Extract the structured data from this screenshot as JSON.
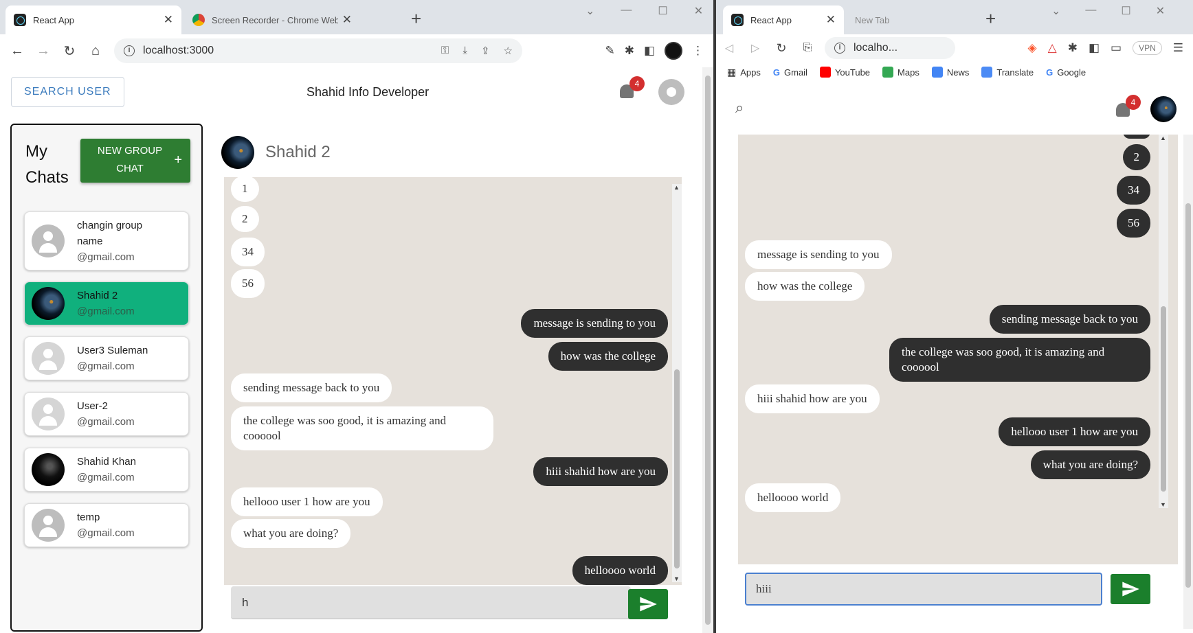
{
  "left_window": {
    "tabs": [
      {
        "title": "React App",
        "active": true
      },
      {
        "title": "Screen Recorder - Chrome Web Sto",
        "active": false
      }
    ],
    "url": "localhost:3000",
    "header": {
      "search_button": "SEARCH USER",
      "brand": "Shahid Info Developer",
      "notification_count": "4"
    },
    "sidebar": {
      "title_line1": "My",
      "title_line2": "Chats",
      "new_group_line1": "NEW GROUP",
      "new_group_line2": "CHAT",
      "new_group_icon": "+",
      "chats": [
        {
          "name": "changin group",
          "name2": "name",
          "email": "@gmail.com",
          "selected": false
        },
        {
          "name": "Shahid 2",
          "email": "@gmail.com",
          "selected": true
        },
        {
          "name": "User3 Suleman",
          "email": "@gmail.com",
          "selected": false
        },
        {
          "name": "User-2",
          "email": "@gmail.com",
          "selected": false
        },
        {
          "name": "Shahid Khan",
          "email": "@gmail.com",
          "selected": false
        },
        {
          "name": "temp",
          "email": "@gmail.com",
          "selected": false
        }
      ]
    },
    "chat": {
      "recipient": "Shahid 2",
      "messages": [
        {
          "text": "1",
          "dir": "in"
        },
        {
          "text": "2",
          "dir": "in"
        },
        {
          "text": "34",
          "dir": "in"
        },
        {
          "text": "56",
          "dir": "in"
        },
        {
          "text": "message is sending to you",
          "dir": "out"
        },
        {
          "text": "how was the college",
          "dir": "out"
        },
        {
          "text": "sending message back to you",
          "dir": "in"
        },
        {
          "text": "the college was soo good, it is amazing and coooool",
          "dir": "in"
        },
        {
          "text": "hiii shahid how are you",
          "dir": "out"
        },
        {
          "text": "hellooo user 1 how are you",
          "dir": "in"
        },
        {
          "text": "what you are doing?",
          "dir": "in"
        },
        {
          "text": "helloooo world",
          "dir": "out"
        }
      ],
      "input_value": "h"
    }
  },
  "right_window": {
    "tabs": [
      {
        "title": "React App",
        "active": true
      },
      {
        "title": "New Tab",
        "active": false
      }
    ],
    "url": "localho...",
    "bookmarks": [
      "Apps",
      "Gmail",
      "YouTube",
      "Maps",
      "News",
      "Translate",
      "Google"
    ],
    "vpn_label": "VPN",
    "notification_count": "4",
    "messages": [
      {
        "text": "2",
        "dir": "out"
      },
      {
        "text": "34",
        "dir": "out"
      },
      {
        "text": "56",
        "dir": "out"
      },
      {
        "text": "message is sending to you",
        "dir": "in"
      },
      {
        "text": "how was the college",
        "dir": "in"
      },
      {
        "text": "sending message back to you",
        "dir": "out"
      },
      {
        "text": "the college was soo good, it is amazing and coooool",
        "dir": "out"
      },
      {
        "text": "hiii shahid how are you",
        "dir": "in"
      },
      {
        "text": "hellooo user 1 how are you",
        "dir": "out"
      },
      {
        "text": "what you are doing?",
        "dir": "out"
      },
      {
        "text": "helloooo world",
        "dir": "in"
      }
    ],
    "input_value": "hiii"
  },
  "colors": {
    "selected_chat": "#10b07d",
    "new_group_button": "#2e7d32",
    "send_button": "#1b7f2c",
    "outgoing_bubble": "#2f2f2f",
    "chat_background": "#e6e1db",
    "badge": "#d32f2f"
  },
  "icons": [
    "react-icon",
    "chrome-icon",
    "back-icon",
    "forward-icon",
    "reload-icon",
    "home-icon",
    "info-icon",
    "key-icon",
    "star-icon",
    "extensions-icon",
    "bell-icon",
    "user-icon",
    "search-icon",
    "send-icon",
    "plus-icon",
    "close-icon",
    "brave-icon"
  ]
}
